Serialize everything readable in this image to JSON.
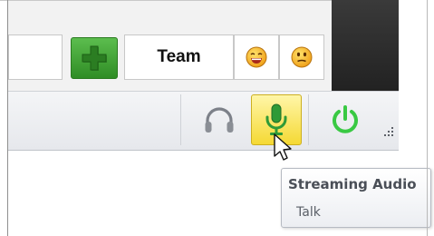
{
  "toolbar": {
    "add_icon": "plus-icon",
    "team_label": "Team",
    "emoticon_happy": "laughing-face-icon",
    "emoticon_neutral": "neutral-face-icon"
  },
  "statusbar": {
    "headphones_icon": "headphones-icon",
    "microphone_icon": "microphone-icon",
    "power_icon": "power-icon",
    "active_color": "#f5d934",
    "power_color": "#39c943"
  },
  "tooltip": {
    "title": "Streaming Audio",
    "subtitle": "Talk"
  }
}
